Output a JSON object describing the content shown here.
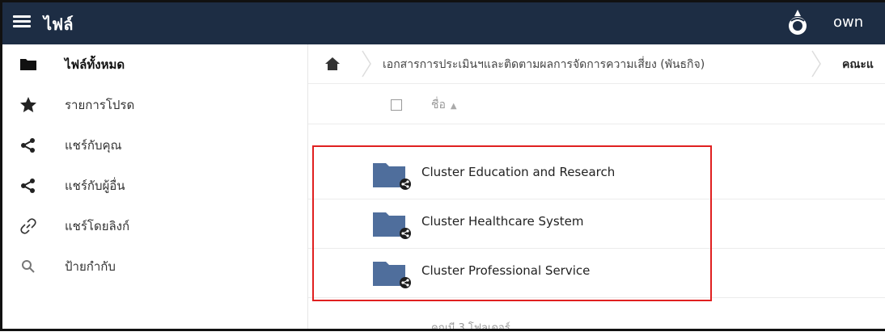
{
  "header": {
    "app_title": "ไฟล์",
    "user_name": "own"
  },
  "sidebar": {
    "items": [
      {
        "label": "ไฟล์ทั้งหมด",
        "icon": "folder-icon",
        "active": true
      },
      {
        "label": "รายการโปรด",
        "icon": "star-icon"
      },
      {
        "label": "แชร์กับคุณ",
        "icon": "share-icon"
      },
      {
        "label": "แชร์กับผู้อื่น",
        "icon": "share-icon"
      },
      {
        "label": "แชร์โดยลิงก์",
        "icon": "link-icon"
      },
      {
        "label": "ป้ายกำกับ",
        "icon": "search-icon"
      }
    ]
  },
  "breadcrumb": {
    "items": [
      "เอกสารการประเมินฯและติดตามผลการจัดการความเสี่ยง (พันธกิจ)",
      "คณะแ"
    ]
  },
  "list": {
    "column_name": "ชื่อ",
    "folders": [
      {
        "name": "Cluster Education and Research"
      },
      {
        "name": "Cluster Healthcare System"
      },
      {
        "name": "Cluster Professional Service"
      }
    ],
    "summary": "คณมี 3 โฟลเดอร์"
  },
  "colors": {
    "header_bg": "#1d2d44",
    "folder": "#4f6e9c",
    "highlight": "#e02020"
  }
}
